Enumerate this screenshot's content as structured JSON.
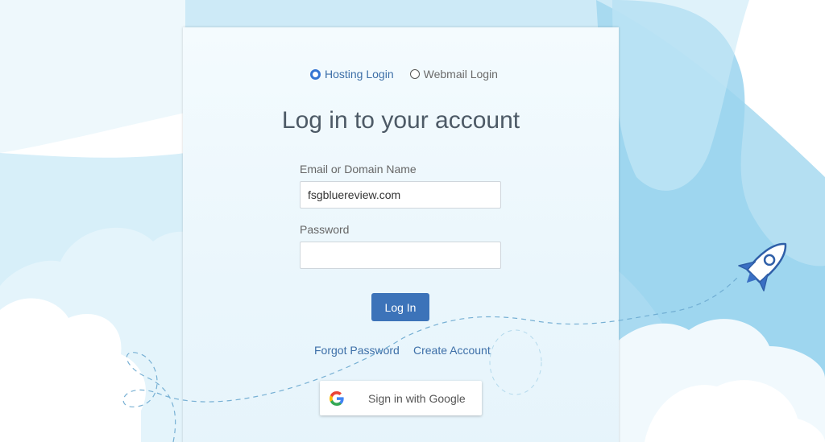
{
  "login_type": {
    "options": [
      {
        "label": "Hosting Login",
        "selected": true
      },
      {
        "label": "Webmail Login",
        "selected": false
      }
    ]
  },
  "title": "Log in to your account",
  "form": {
    "email_label": "Email or Domain Name",
    "email_value": "fsgbluereview.com",
    "password_label": "Password",
    "password_value": "",
    "submit_label": "Log In"
  },
  "links": {
    "forgot_password": "Forgot Password",
    "create_account": "Create Account"
  },
  "google": {
    "label": "Sign in with Google",
    "icon": "google-g-icon"
  },
  "colors": {
    "accent": "#3c73b9",
    "link": "#3d6fa8",
    "background_sky": "#b7e2f3"
  }
}
